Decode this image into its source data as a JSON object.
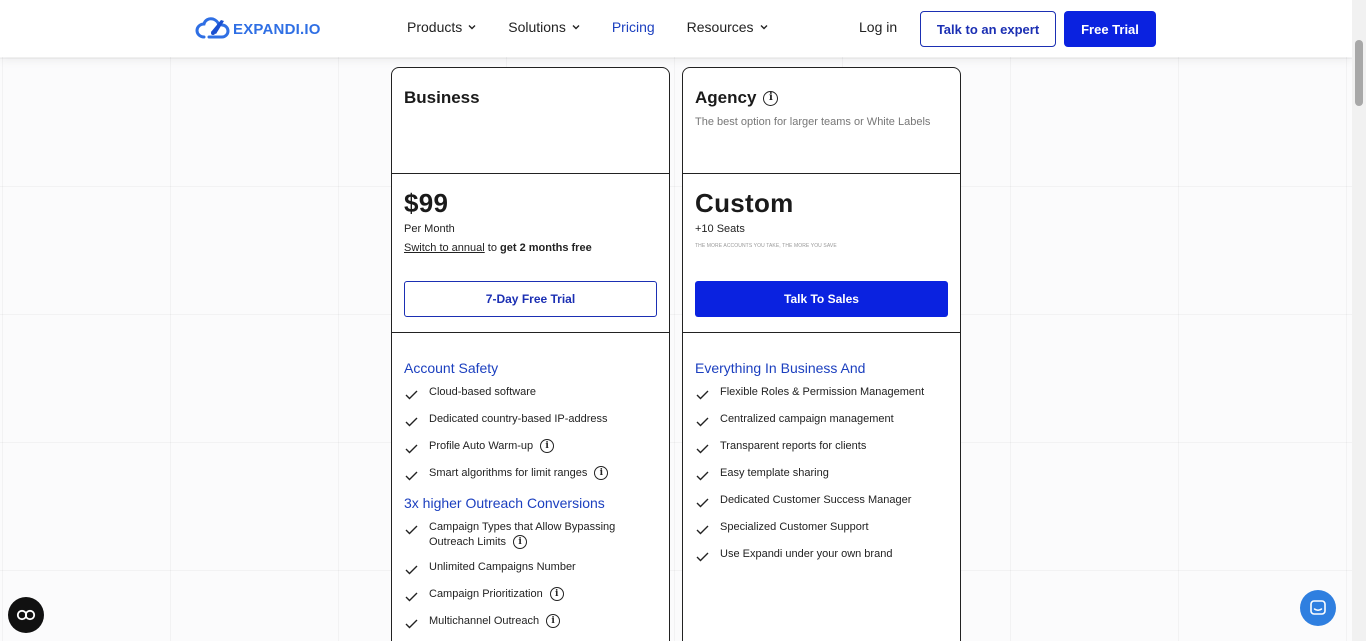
{
  "header": {
    "logo_text": "EXPANDI.IO",
    "nav": [
      {
        "label": "Products",
        "has_dropdown": true,
        "active": false
      },
      {
        "label": "Solutions",
        "has_dropdown": true,
        "active": false
      },
      {
        "label": "Pricing",
        "has_dropdown": false,
        "active": true
      },
      {
        "label": "Resources",
        "has_dropdown": true,
        "active": false
      }
    ],
    "login_label": "Log in",
    "expert_label": "Talk to an expert",
    "trial_label": "Free Trial"
  },
  "plans": {
    "business": {
      "name": "Business",
      "price": "$99",
      "period": "Per Month",
      "switch_link": "Switch to annual",
      "switch_mid": " to ",
      "switch_bold": "get 2 months free",
      "cta": "7-Day Free Trial",
      "sections": [
        {
          "title": "Account Safety",
          "features": [
            {
              "text": "Cloud-based software",
              "info": false
            },
            {
              "text": "Dedicated country-based IP-address",
              "info": false
            },
            {
              "text": "Profile Auto Warm-up",
              "info": true
            },
            {
              "text": "Smart algorithms for limit ranges",
              "info": true
            }
          ]
        },
        {
          "title": "3x higher Outreach Conversions",
          "features": [
            {
              "text": "Campaign Types that Allow Bypassing Outreach Limits",
              "info": true
            },
            {
              "text": "Unlimited Campaigns Number",
              "info": false
            },
            {
              "text": "Campaign Prioritization",
              "info": true
            },
            {
              "text": "Multichannel Outreach",
              "info": true
            }
          ]
        }
      ]
    },
    "agency": {
      "name": "Agency",
      "subtitle": "The best option for larger teams or White Labels",
      "price": "Custom",
      "seats": "+10 Seats",
      "tiny_note": "THE MORE ACCOUNTS YOU TAKE, THE MORE YOU SAVE",
      "cta": "Talk To Sales",
      "sections": [
        {
          "title": "Everything In Business And",
          "features": [
            {
              "text": "Flexible Roles & Permission Management",
              "info": false
            },
            {
              "text": "Centralized campaign management",
              "info": false
            },
            {
              "text": "Transparent reports for clients",
              "info": false
            },
            {
              "text": "Easy template sharing",
              "info": false
            },
            {
              "text": "Dedicated Customer Success Manager",
              "info": false
            },
            {
              "text": "Specialized Customer Support",
              "info": false
            },
            {
              "text": "Use Expandi under your own brand",
              "info": false
            }
          ]
        }
      ]
    }
  },
  "icons": {
    "info_glyph": "i",
    "cookie_glyph": "CO",
    "accent_color": "#0a22e0",
    "link_color": "#1b3fbf",
    "chat_color": "#2f7fe0"
  }
}
